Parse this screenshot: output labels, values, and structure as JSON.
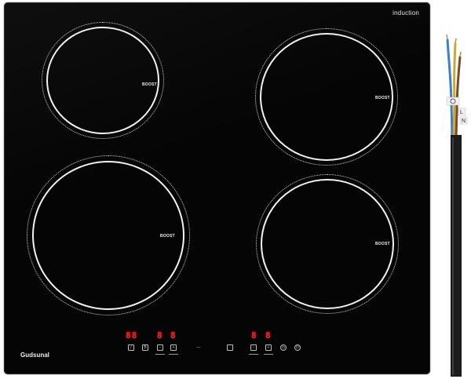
{
  "hob": {
    "type_label": "induction",
    "brand": "Gudsunal"
  },
  "zones": [
    {
      "id": "rear-left",
      "label": "BOOST"
    },
    {
      "id": "rear-right",
      "label": "BOOST"
    },
    {
      "id": "front-left",
      "label": "BOOST"
    },
    {
      "id": "front-right",
      "label": "BOOST"
    }
  ],
  "display": {
    "digits_1": "88",
    "digits_2": "8",
    "digits_3": "8",
    "digits_4": "8",
    "digits_5": "8"
  },
  "cable": {
    "label_l": "L",
    "label_n": "N",
    "wire_colors": [
      "#3a7fd0",
      "#caa832",
      "#7a4a22",
      "#2f2f2f"
    ]
  },
  "colors": {
    "glass": "#050505",
    "led": "#ff2222",
    "ring": "#f2f2f2"
  }
}
